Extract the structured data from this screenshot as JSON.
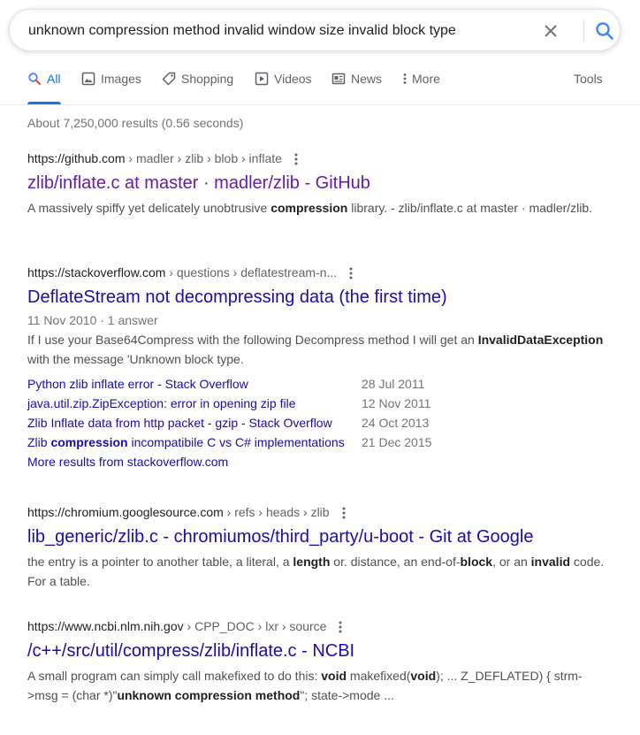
{
  "search": {
    "query": "unknown compression method invalid window size invalid block type"
  },
  "tabs": [
    {
      "label": "All"
    },
    {
      "label": "Images"
    },
    {
      "label": "Shopping"
    },
    {
      "label": "Videos"
    },
    {
      "label": "News"
    },
    {
      "label": "More"
    }
  ],
  "tools_label": "Tools",
  "stats": "About 7,250,000 results (0.56 seconds)",
  "results": [
    {
      "domain": "https://github.com",
      "path": " › madler › zlib › blob › inflate",
      "title": "zlib/inflate.c at master · madler/zlib - GitHub",
      "snippet_parts": [
        "A massively spiffy yet delicately unobtrusive ",
        "compression",
        " library. - zlib/inflate.c at master · madler/zlib."
      ]
    },
    {
      "domain": "https://stackoverflow.com",
      "path": " › questions › deflatestream-n...",
      "title": "DeflateStream not decompressing data (the first time)",
      "date": "11 Nov 2010 · 1 answer",
      "snippet_parts": [
        "If I use your Base64Compress with the following Decompress method I will get an ",
        "InvalidDataException",
        " with the message 'Unknown block type."
      ],
      "sublinks": [
        {
          "pre": "Python zlib inflate error - Stack Overflow",
          "bold": "",
          "post": "",
          "date": "28 Jul 2011"
        },
        {
          "pre": "java.util.zip.ZipException: error in opening zip file",
          "bold": "",
          "post": "",
          "date": "12 Nov 2011"
        },
        {
          "pre": "Zlib Inflate data from http packet - gzip - Stack Overflow",
          "bold": "",
          "post": "",
          "date": "24 Oct 2013"
        },
        {
          "pre": "Zlib ",
          "bold": "compression",
          "post": " incompatibile C vs C# implementations",
          "date": "21 Dec 2015"
        }
      ],
      "more_results": "More results from stackoverflow.com"
    },
    {
      "domain": "https://chromium.googlesource.com",
      "path": " › refs › heads › zlib",
      "title": "lib_generic/zlib.c - chromiumos/third_party/u-boot - Git at Google",
      "snippet_parts": [
        "the entry is a pointer to another table, a literal, a ",
        "length",
        " or. distance, an end-of-",
        "block",
        ", or an ",
        "invalid",
        " code. For a table."
      ]
    },
    {
      "domain": "https://www.ncbi.nlm.nih.gov",
      "path": " › CPP_DOC › lxr › source",
      "title": "/c++/src/util/compress/zlib/inflate.c - NCBI",
      "snippet_parts": [
        "A small program can simply call makefixed to do this: ",
        "void",
        " makefixed(",
        "void",
        "); ... Z_DEFLATED) { strm->msg = (char *)\"",
        "unknown compression method",
        "\"; state->mode ..."
      ]
    }
  ],
  "colors": {
    "link": "#1a0dab",
    "visited": "#681da8",
    "accent": "#1a73e8"
  },
  "icons": [
    "clear-icon",
    "search-icon",
    "images-icon",
    "shopping-tag-icon",
    "videos-play-icon",
    "news-icon",
    "more-dots-icon",
    "kebab-menu-icon"
  ]
}
